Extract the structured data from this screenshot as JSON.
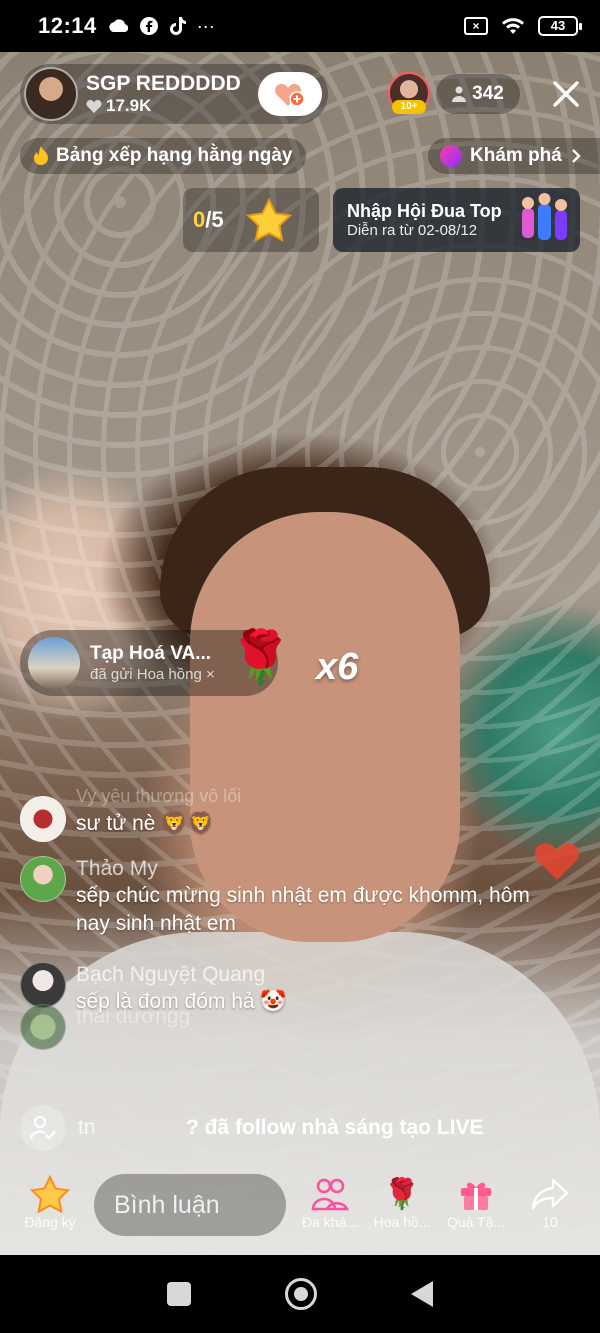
{
  "status_bar": {
    "time": "12:14",
    "battery": "43",
    "left_icons": [
      "cloud-icon",
      "facebook-icon",
      "tiktok-icon",
      "more-dots-icon"
    ],
    "more": "···"
  },
  "host": {
    "name": "SGP REDDDDD",
    "likes": "17.9K"
  },
  "viewers": {
    "badge": "10+",
    "count": "342"
  },
  "rank_label": "Bảng xếp hạng hằng ngày",
  "explore_label": "Khám phá",
  "task": {
    "done": "0",
    "total": "/5"
  },
  "event": {
    "title": "Nhập Hội Đua Top",
    "subtitle": "Diễn ra từ 02-08/12"
  },
  "gift": {
    "sender": "Tạp Hoá VA...",
    "action": "đã gửi Hoa hồng ×",
    "count": "x6"
  },
  "chat": {
    "faded_name": "Vy yêu thương vô lối",
    "messages": [
      {
        "name": "",
        "text": "sư tử nè 🦁🦁"
      },
      {
        "name": "Thảo My",
        "text": "sếp chúc mừng sinh nhật em được khomm, hôm nay sinh nhật em"
      },
      {
        "name": "Bạch Nguyệt Quang",
        "text": "sếp là đom đóm hả 🤡"
      },
      {
        "name": "thái dươngg",
        "text": ""
      }
    ]
  },
  "follow_notice": {
    "user": "tn",
    "text": "? đã follow nhà sáng tạo LIVE"
  },
  "toolbar": {
    "subscribe": "Đăng ký",
    "comment_placeholder": "Bình luận",
    "guests": "Đa khá...",
    "rose": "Hoa hồ...",
    "gifts": "Quà Tặ...",
    "share_count": "10"
  },
  "colors": {
    "accent_yellow": "#ffd23a",
    "heart_red": "#e8442d",
    "pink": "#ff3fa8"
  }
}
